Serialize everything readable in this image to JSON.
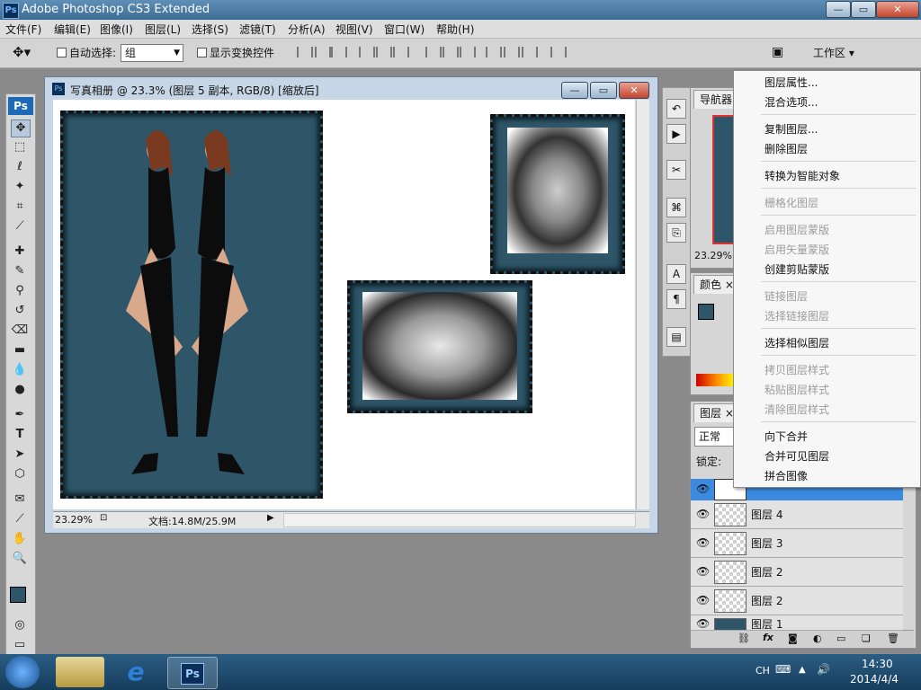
{
  "titlebar": {
    "title": "Adobe Photoshop CS3 Extended",
    "icon": "Ps"
  },
  "menubar": [
    "文件(F)",
    "编辑(E)",
    "图像(I)",
    "图层(L)",
    "选择(S)",
    "滤镜(T)",
    "分析(A)",
    "视图(V)",
    "窗口(W)",
    "帮助(H)"
  ],
  "options": {
    "auto_select_label": "自动选择:",
    "auto_select_value": "组",
    "show_transform_label": "显示变换控件",
    "workspace_label": "工作区"
  },
  "document": {
    "title": "写真相册 @ 23.3% (图层 5 副本, RGB/8) [缩放后]",
    "zoom": "23.29%",
    "doc_info": "文档:14.8M/25.9M"
  },
  "panels": {
    "navigator_tab": "导航器",
    "navigator_zoom": "23.29%",
    "color_tab": "颜色",
    "layers_tab": "图层",
    "blend_mode": "正常",
    "lock_label": "锁定:"
  },
  "layers": [
    {
      "name": "图层 4"
    },
    {
      "name": "图层 3"
    },
    {
      "name": "图层 2"
    },
    {
      "name": "图层 2"
    },
    {
      "name": "图层 1"
    }
  ],
  "context_menu": {
    "items": [
      {
        "label": "图层属性...",
        "enabled": true
      },
      {
        "label": "混合选项...",
        "enabled": true
      },
      {
        "label": "复制图层...",
        "enabled": true
      },
      {
        "label": "删除图层",
        "enabled": true
      },
      {
        "label": "转换为智能对象",
        "enabled": true
      },
      {
        "label": "栅格化图层",
        "enabled": false
      },
      {
        "label": "启用图层蒙版",
        "enabled": false
      },
      {
        "label": "启用矢量蒙版",
        "enabled": false
      },
      {
        "label": "创建剪贴蒙版",
        "enabled": true
      },
      {
        "label": "链接图层",
        "enabled": false
      },
      {
        "label": "选择链接图层",
        "enabled": false
      },
      {
        "label": "选择相似图层",
        "enabled": true
      },
      {
        "label": "拷贝图层样式",
        "enabled": false
      },
      {
        "label": "粘贴图层样式",
        "enabled": false
      },
      {
        "label": "清除图层样式",
        "enabled": false
      },
      {
        "label": "向下合并",
        "enabled": true
      },
      {
        "label": "合并可见图层",
        "enabled": true
      },
      {
        "label": "拼合图像",
        "enabled": true
      }
    ]
  },
  "taskbar": {
    "lang": "CH",
    "time": "14:30",
    "date": "2014/4/4",
    "ps_label": "Ps"
  },
  "colors": {
    "frame_teal": "#2e5668",
    "foreground": "#2e5668"
  }
}
